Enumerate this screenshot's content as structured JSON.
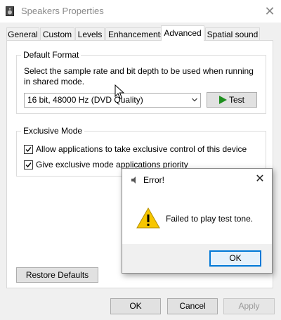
{
  "window": {
    "title": "Speakers Properties",
    "close_glyph": "✕"
  },
  "tabs": [
    {
      "label": "General",
      "active": false
    },
    {
      "label": "Custom",
      "active": false
    },
    {
      "label": "Levels",
      "active": false
    },
    {
      "label": "Enhancements",
      "active": false
    },
    {
      "label": "Advanced",
      "active": true
    },
    {
      "label": "Spatial sound",
      "active": false
    }
  ],
  "default_format": {
    "legend": "Default Format",
    "description_line1": "Select the sample rate and bit depth to be used when running",
    "description_line2": "in shared mode.",
    "selected_value": "16 bit, 48000 Hz (DVD Quality)",
    "test_button": "Test"
  },
  "exclusive_mode": {
    "legend": "Exclusive Mode",
    "options": [
      {
        "label": "Allow applications to take exclusive control of this device",
        "checked": true
      },
      {
        "label": "Give exclusive mode applications priority",
        "checked": true
      }
    ]
  },
  "restore_defaults": "Restore Defaults",
  "footer": {
    "ok": "OK",
    "cancel": "Cancel",
    "apply": "Apply",
    "apply_enabled": false
  },
  "error_dialog": {
    "title": "Error!",
    "close_glyph": "✕",
    "message": "Failed to play test tone.",
    "ok": "OK",
    "icon": "warning-icon"
  },
  "colors": {
    "accent": "#0078d7",
    "test_play": "#1e8f1e",
    "warning": "#f7c600"
  }
}
